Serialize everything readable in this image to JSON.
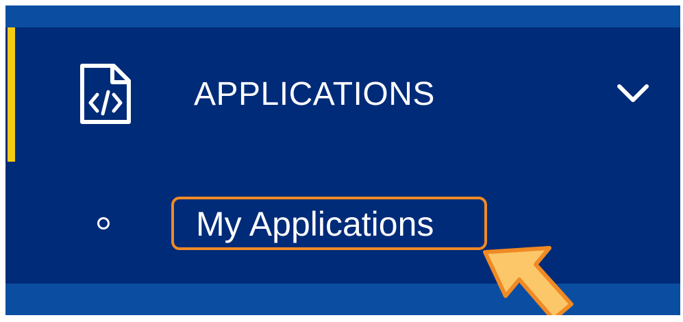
{
  "menu": {
    "icon": "code-file-icon",
    "label": "APPLICATIONS",
    "expand_icon": "chevron-down-icon",
    "active_indicator_color": "#f5cc14",
    "submenu": [
      {
        "label": "My Applications",
        "bullet_icon": "circle-bullet-icon"
      }
    ]
  },
  "overlay": {
    "highlight_color": "#f08a24",
    "arrow_icon": "pointer-arrow-icon",
    "arrow_color": "#fcc768"
  },
  "colors": {
    "nav_background": "#002b78",
    "frame_background": "#0b4ea1",
    "text": "#ffffff"
  }
}
